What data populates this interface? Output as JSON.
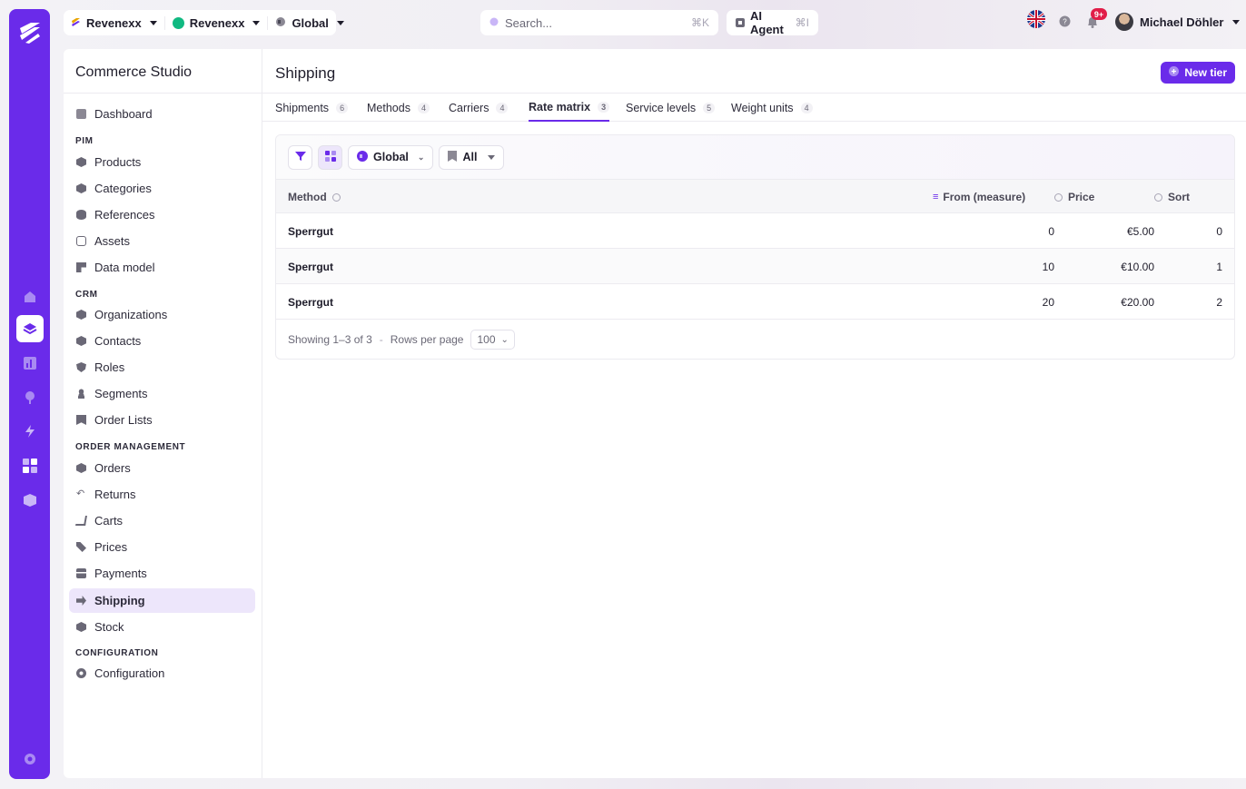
{
  "topbar": {
    "org_label": "Revenexx",
    "workspace_label": "Revenexx",
    "scope_label": "Global",
    "search_placeholder": "Search...",
    "search_shortcut": "⌘K",
    "agent_label": "AI Agent",
    "agent_shortcut": "⌘I",
    "notification_badge": "9+",
    "user_name": "Michael Döhler",
    "language": "uk-flag-icon"
  },
  "sidebar": {
    "title": "Commerce Studio",
    "dashboard": "Dashboard",
    "sections": {
      "pim": "PIM",
      "crm": "CRM",
      "order": "ORDER MANAGEMENT",
      "config": "CONFIGURATION"
    },
    "items": {
      "products": "Products",
      "categories": "Categories",
      "references": "References",
      "assets": "Assets",
      "data_model": "Data model",
      "organizations": "Organizations",
      "contacts": "Contacts",
      "roles": "Roles",
      "segments": "Segments",
      "order_lists": "Order Lists",
      "orders": "Orders",
      "returns": "Returns",
      "carts": "Carts",
      "prices": "Prices",
      "payments": "Payments",
      "shipping": "Shipping",
      "stock": "Stock",
      "configuration": "Configuration"
    }
  },
  "page": {
    "title": "Shipping",
    "new_button": "New tier",
    "tabs": [
      {
        "label": "Shipments",
        "count": "6"
      },
      {
        "label": "Methods",
        "count": "4"
      },
      {
        "label": "Carriers",
        "count": "4"
      },
      {
        "label": "Rate matrix",
        "count": "3"
      },
      {
        "label": "Service levels",
        "count": "5"
      },
      {
        "label": "Weight units",
        "count": "4"
      }
    ]
  },
  "filters": {
    "scope": "Global",
    "bookmark": "All"
  },
  "table": {
    "columns": {
      "method": "Method",
      "from": "From (measure)",
      "price": "Price",
      "sort": "Sort"
    },
    "rows": [
      {
        "method": "Sperrgut",
        "from": "0",
        "price": "€5.00",
        "sort": "0"
      },
      {
        "method": "Sperrgut",
        "from": "10",
        "price": "€10.00",
        "sort": "1"
      },
      {
        "method": "Sperrgut",
        "from": "20",
        "price": "€20.00",
        "sort": "2"
      }
    ]
  },
  "footer": {
    "showing": "Showing 1–3 of 3",
    "separator": "-",
    "rows_label": "Rows per page",
    "rows_value": "100"
  },
  "colors": {
    "accent": "#6a2bea",
    "active_bg": "#ede6fb"
  }
}
